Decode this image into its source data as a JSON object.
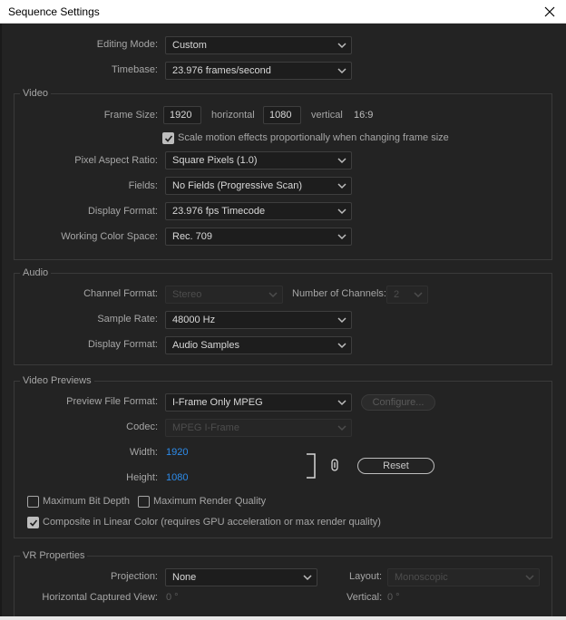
{
  "window": {
    "title": "Sequence Settings",
    "close_icon": "close-icon"
  },
  "top": {
    "editing_mode": {
      "label": "Editing Mode:",
      "value": "Custom"
    },
    "timebase": {
      "label": "Timebase:",
      "value": "23.976  frames/second"
    }
  },
  "video": {
    "title": "Video",
    "frame_size": {
      "label": "Frame Size:",
      "width": "1920",
      "horizontal_label": "horizontal",
      "height": "1080",
      "vertical_label": "vertical",
      "aspect": "16:9"
    },
    "scale_motion": {
      "label": "Scale motion effects proportionally when changing frame size",
      "checked": true
    },
    "pixel_aspect": {
      "label": "Pixel Aspect Ratio:",
      "value": "Square Pixels (1.0)"
    },
    "fields": {
      "label": "Fields:",
      "value": "No Fields (Progressive Scan)"
    },
    "display_format": {
      "label": "Display Format:",
      "value": "23.976 fps Timecode"
    },
    "working_color": {
      "label": "Working Color Space:",
      "value": "Rec. 709"
    }
  },
  "audio": {
    "title": "Audio",
    "channel_format": {
      "label": "Channel Format:",
      "value": "Stereo"
    },
    "num_channels": {
      "label": "Number of Channels:",
      "value": "2"
    },
    "sample_rate": {
      "label": "Sample Rate:",
      "value": "48000 Hz"
    },
    "display_format": {
      "label": "Display Format:",
      "value": "Audio Samples"
    }
  },
  "previews": {
    "title": "Video Previews",
    "file_format": {
      "label": "Preview File Format:",
      "value": "I-Frame Only MPEG"
    },
    "configure_label": "Configure...",
    "codec": {
      "label": "Codec:",
      "value": "MPEG I-Frame"
    },
    "width": {
      "label": "Width:",
      "value": "1920"
    },
    "height": {
      "label": "Height:",
      "value": "1080"
    },
    "reset_label": "Reset",
    "max_bit_depth": {
      "label": "Maximum Bit Depth",
      "checked": false
    },
    "max_render_quality": {
      "label": "Maximum Render Quality",
      "checked": false
    },
    "composite_linear": {
      "label": "Composite in Linear Color (requires GPU acceleration or max render quality)",
      "checked": true
    }
  },
  "vr": {
    "title": "VR Properties",
    "projection": {
      "label": "Projection:",
      "value": "None"
    },
    "layout": {
      "label": "Layout:",
      "value": "Monoscopic"
    },
    "h_view": {
      "label": "Horizontal Captured View:",
      "value": "0 °"
    },
    "vertical": {
      "label": "Vertical:",
      "value": "0 °"
    }
  },
  "colors": {
    "accent_blue": "#2d8ceb",
    "background": "#232323",
    "titlebar": "#ffffff"
  }
}
